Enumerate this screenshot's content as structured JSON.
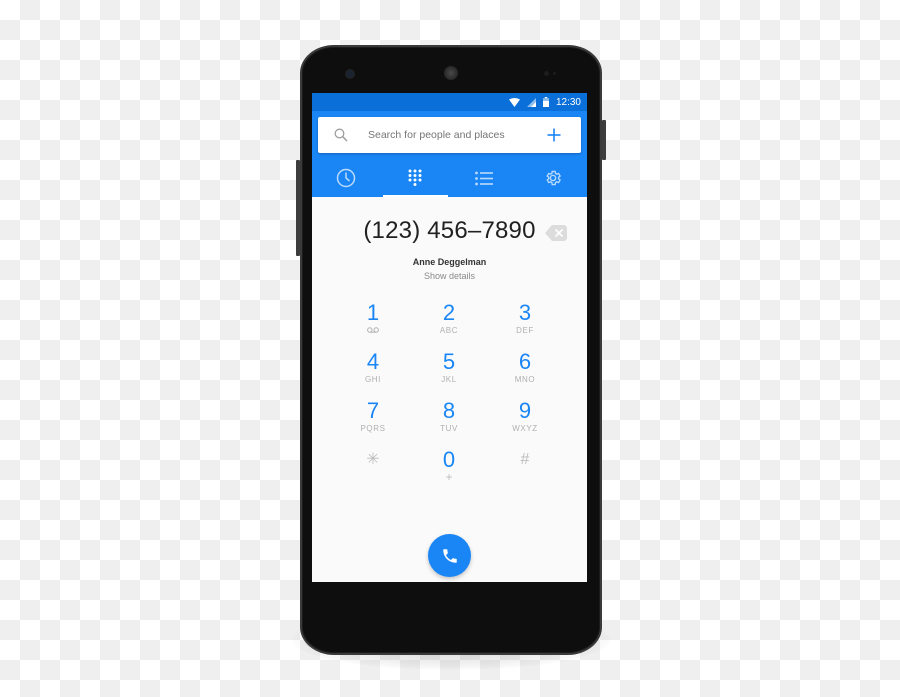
{
  "status_bar": {
    "time": "12:30",
    "icons": [
      "wifi-icon",
      "signal-icon",
      "battery-icon"
    ]
  },
  "search": {
    "placeholder": "Search for people and places",
    "left_icon": "search-icon",
    "right_icon": "add-icon"
  },
  "tabs": [
    {
      "name": "recents",
      "icon": "clock-icon",
      "active": false
    },
    {
      "name": "dialpad",
      "icon": "dialpad-icon",
      "active": true
    },
    {
      "name": "contacts",
      "icon": "list-icon",
      "active": false
    },
    {
      "name": "settings",
      "icon": "gear-icon",
      "active": false
    }
  ],
  "dialer": {
    "number": "(123) 456–7890",
    "contact_name": "Anne Deggelman",
    "details_link": "Show details",
    "backspace_icon": "backspace-icon"
  },
  "keypad": [
    {
      "digit": "1",
      "letters": "",
      "sub_icon": "voicemail-icon"
    },
    {
      "digit": "2",
      "letters": "ABC"
    },
    {
      "digit": "3",
      "letters": "DEF"
    },
    {
      "digit": "4",
      "letters": "GHI"
    },
    {
      "digit": "5",
      "letters": "JKL"
    },
    {
      "digit": "6",
      "letters": "MNO"
    },
    {
      "digit": "7",
      "letters": "PQRS"
    },
    {
      "digit": "8",
      "letters": "TUV"
    },
    {
      "digit": "9",
      "letters": "WXYZ"
    },
    {
      "digit": "✳",
      "letters": ""
    },
    {
      "digit": "0",
      "letters": "+"
    },
    {
      "digit": "#",
      "letters": ""
    }
  ],
  "call_button": {
    "icon": "phone-icon"
  },
  "colors": {
    "primary": "#1a86f5",
    "status_bar": "#0a6fd8",
    "background": "#fafafa",
    "phone_body": "#0e0e0e"
  }
}
